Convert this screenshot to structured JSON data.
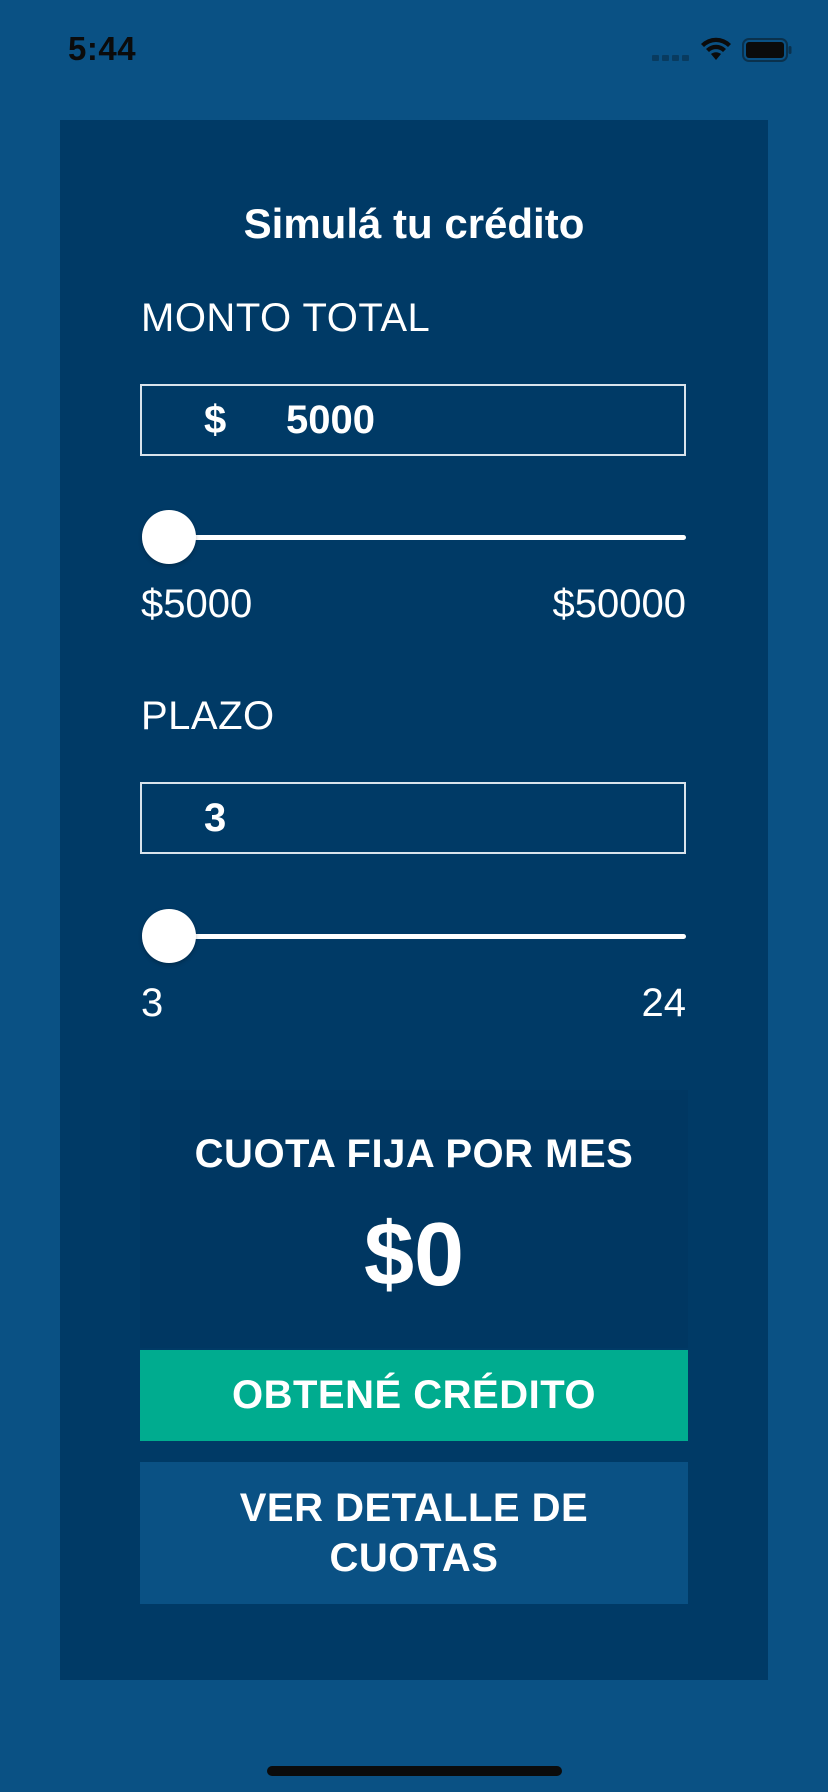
{
  "status_bar": {
    "time": "5:44"
  },
  "form": {
    "title": "Simulá tu crédito",
    "amount": {
      "label": "MONTO TOTAL",
      "currency": "$",
      "value": "5000",
      "min_label": "$5000",
      "max_label": "$50000",
      "slider_fraction": 0
    },
    "term": {
      "label": "PLAZO",
      "value": "3",
      "min_label": "3",
      "max_label": "24",
      "slider_fraction": 0
    }
  },
  "result": {
    "label": "CUOTA FIJA POR MES",
    "value": "$0"
  },
  "buttons": {
    "obtain_credit": "OBTENÉ CRÉDITO",
    "view_details": "VER DETALLE DE CUOTAS"
  },
  "colors": {
    "background": "#0a5184",
    "card": "#003a66",
    "primary_button": "#00ac8f"
  },
  "icons": [
    "signal-icon",
    "wifi-icon",
    "battery-icon"
  ]
}
